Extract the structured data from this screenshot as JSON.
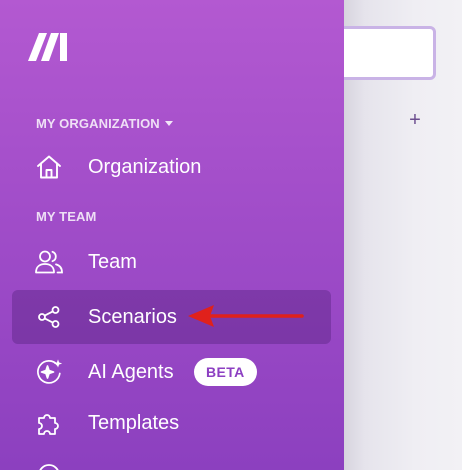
{
  "logo_name": "make-logo",
  "sidebar": {
    "org_section_label": "MY ORGANIZATION",
    "team_section_label": "MY TEAM",
    "items": [
      {
        "label": "Organization",
        "icon": "home-icon"
      },
      {
        "label": "Team",
        "icon": "users-icon"
      },
      {
        "label": "Scenarios",
        "icon": "share-icon",
        "active": true
      },
      {
        "label": "AI Agents",
        "icon": "ai-agent-icon",
        "badge": "BETA"
      },
      {
        "label": "Templates",
        "icon": "puzzle-icon"
      }
    ]
  },
  "main": {
    "add_button": "+"
  },
  "colors": {
    "sidebar_top": "#b359d1",
    "sidebar_bottom": "#8c40bf",
    "active_item_bg": "#7a3fa8",
    "badge_text": "#8c3fc2",
    "annotation_arrow": "#e0211b"
  }
}
